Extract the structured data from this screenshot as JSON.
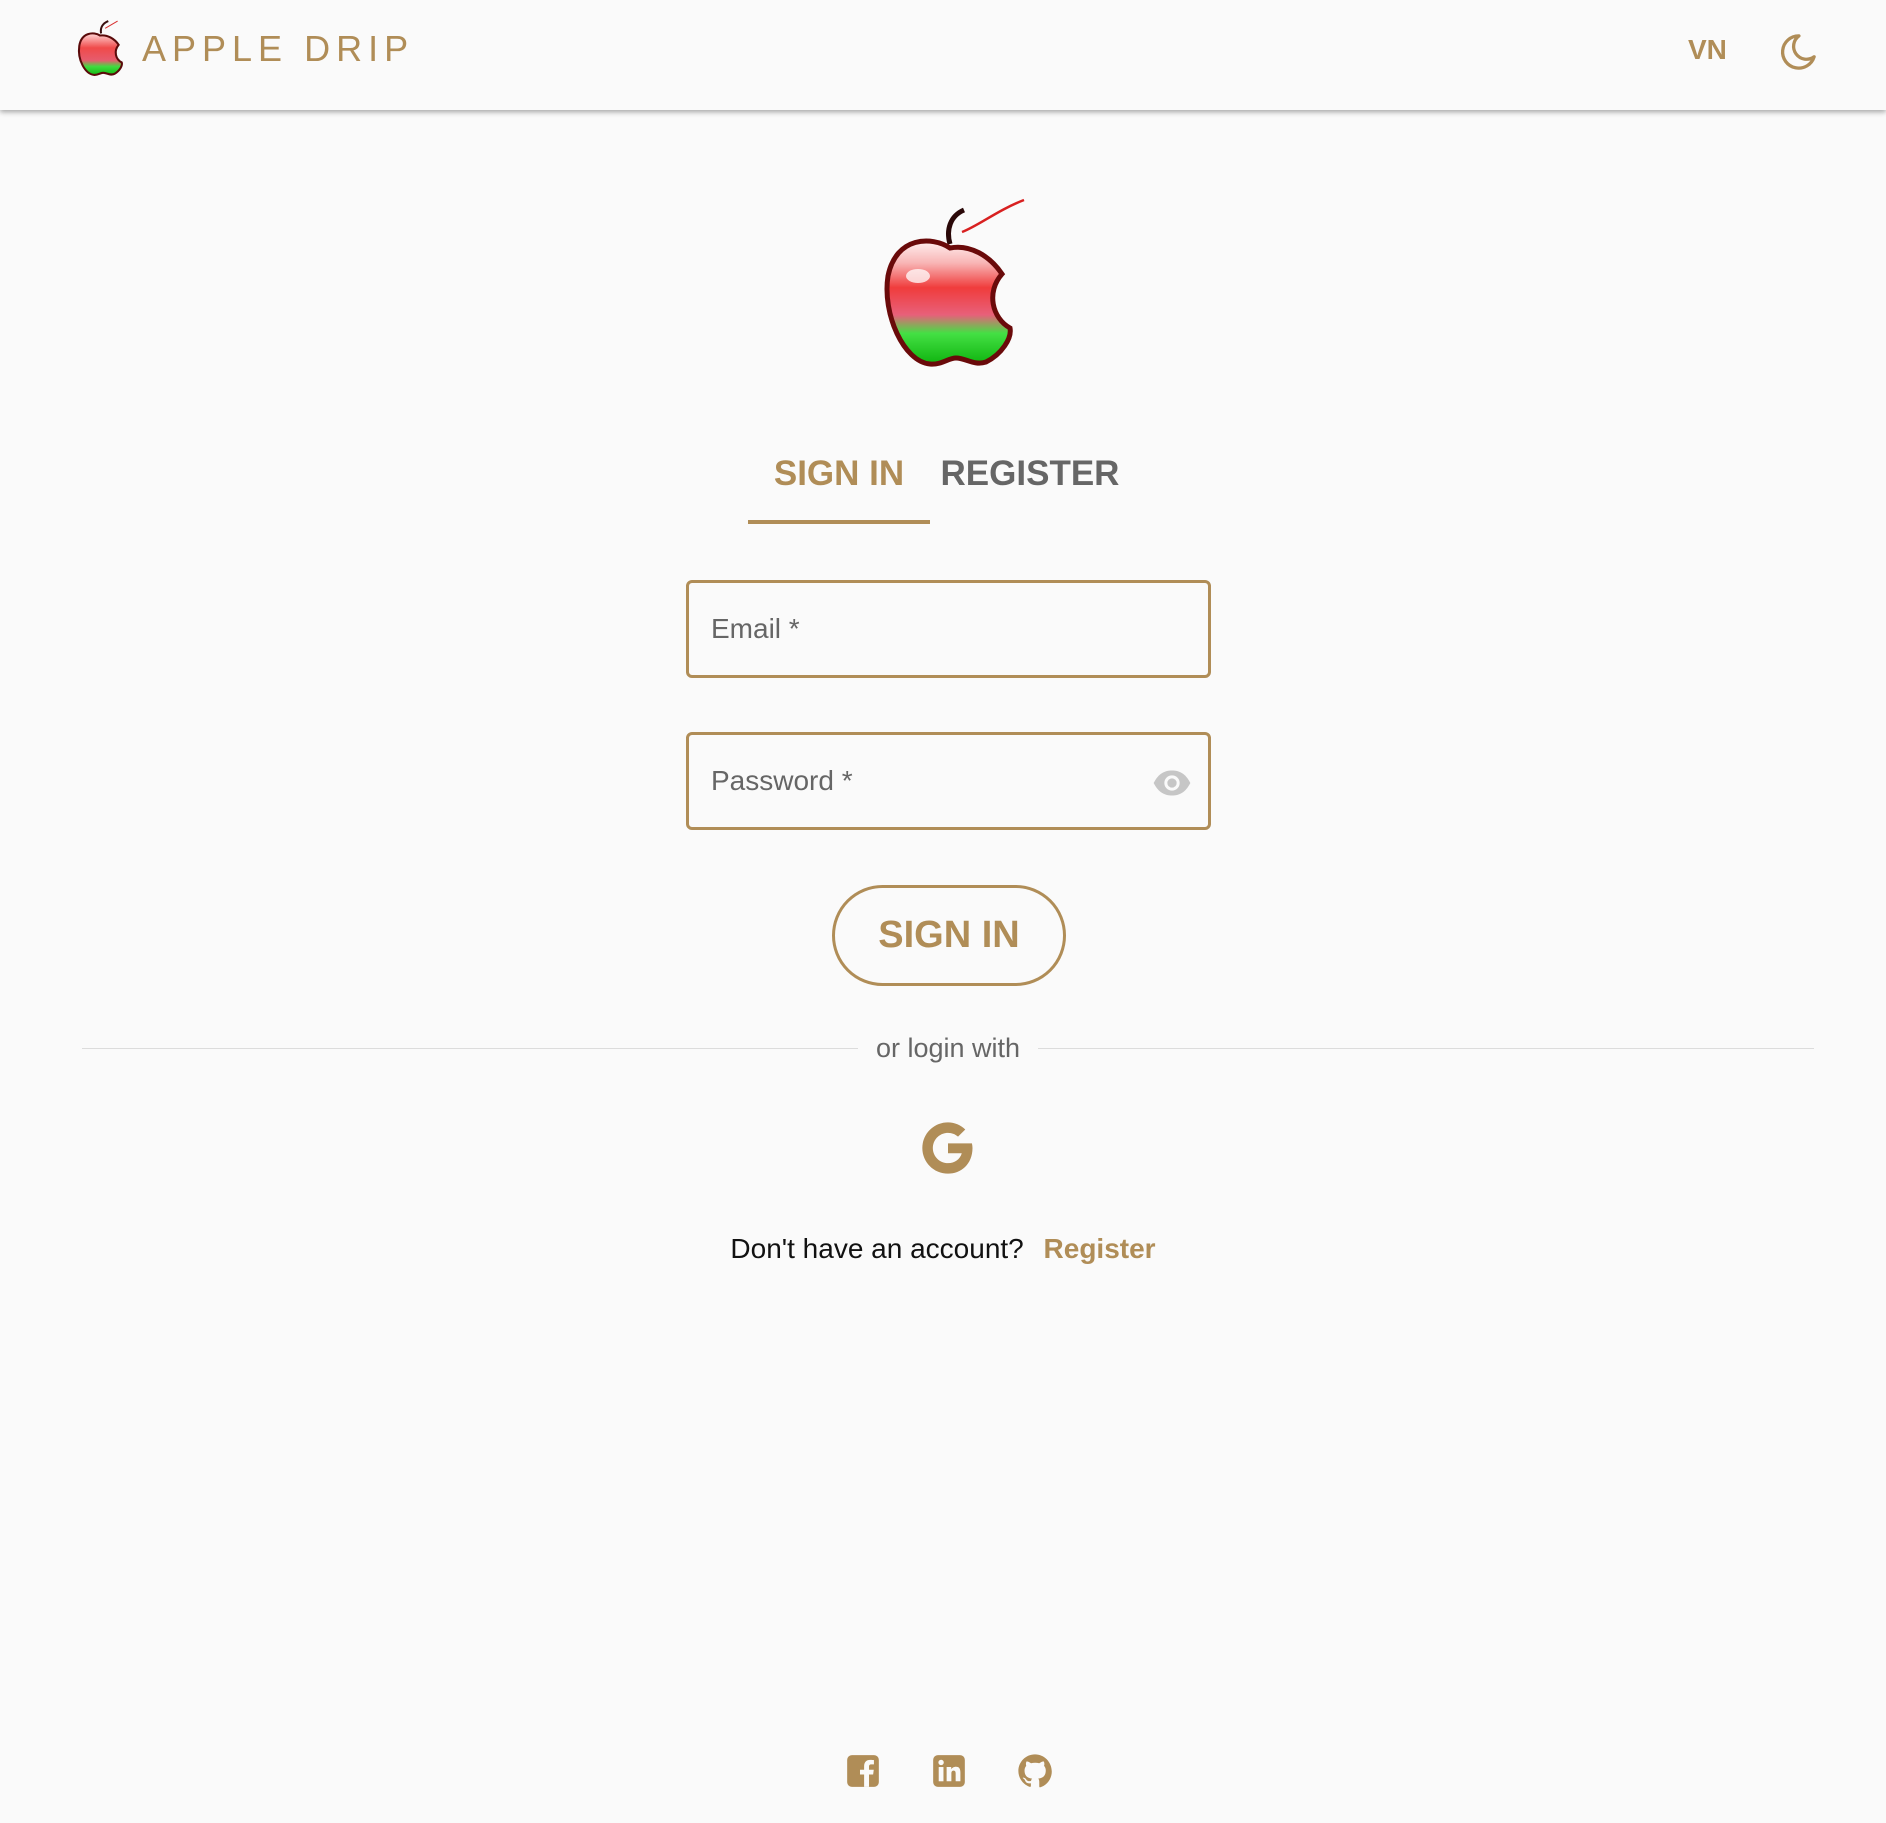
{
  "header": {
    "brand_name": "APPLE DRIP",
    "lang_label": "VN",
    "theme_icon": "moon-icon"
  },
  "logo": {
    "icon": "apple-logo"
  },
  "tabs": [
    {
      "label": "SIGN IN",
      "active": true
    },
    {
      "label": "REGISTER",
      "active": false
    }
  ],
  "form": {
    "email_placeholder": "Email *",
    "password_placeholder": "Password *",
    "eye_icon": "eye-icon",
    "submit_label": "SIGN IN"
  },
  "divider_text": "or login with",
  "social_login": {
    "icon": "google-icon"
  },
  "account": {
    "prompt": "Don't have an account?",
    "link": "Register"
  },
  "footer": {
    "icons": [
      "facebook-icon",
      "linkedin-icon",
      "github-icon"
    ]
  },
  "colors": {
    "accent": "#b08d57",
    "background": "#fafafa",
    "tab_inactive": "#666666"
  }
}
